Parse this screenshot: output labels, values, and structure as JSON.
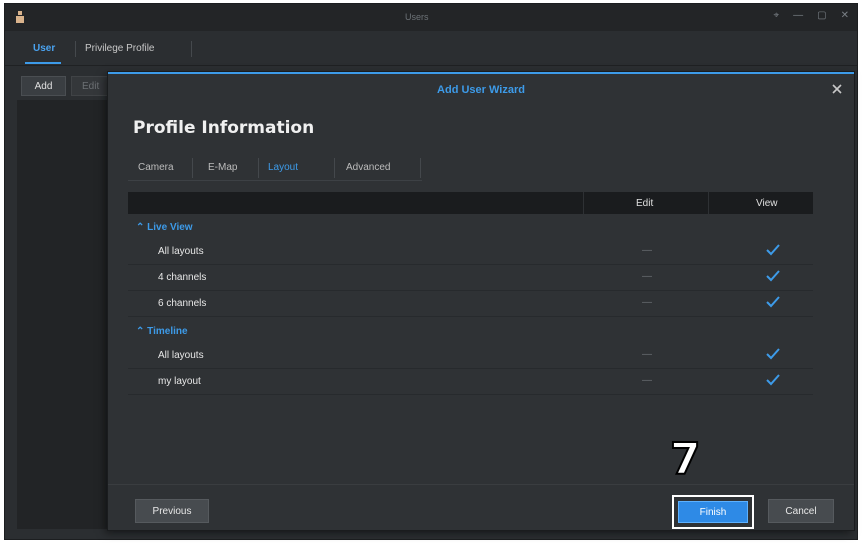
{
  "window": {
    "title": "Users"
  },
  "nav": {
    "tab_user": "User",
    "tab_privilege": "Privilege Profile"
  },
  "toolbar": {
    "add": "Add",
    "edit": "Edit"
  },
  "dialog": {
    "title": "Add User Wizard",
    "heading": "Profile Information",
    "tabs": [
      "Camera",
      "E-Map",
      "Layout",
      "Advanced"
    ],
    "active_tab": "Layout",
    "columns": {
      "name": "",
      "edit": "Edit",
      "view": "View"
    },
    "groups": [
      {
        "label": "Live View",
        "rows": [
          {
            "name": "All layouts",
            "edit": "—",
            "view": true
          },
          {
            "name": "4 channels",
            "edit": "—",
            "view": true
          },
          {
            "name": "6 channels",
            "edit": "—",
            "view": true
          }
        ]
      },
      {
        "label": "Timeline",
        "rows": [
          {
            "name": "All layouts",
            "edit": "—",
            "view": true
          },
          {
            "name": "my layout",
            "edit": "—",
            "view": true
          }
        ]
      }
    ],
    "buttons": {
      "previous": "Previous",
      "finish": "Finish",
      "cancel": "Cancel"
    }
  },
  "annotation": {
    "step": "7"
  },
  "colors": {
    "accent": "#3d9be9",
    "background": "#2f3235"
  }
}
